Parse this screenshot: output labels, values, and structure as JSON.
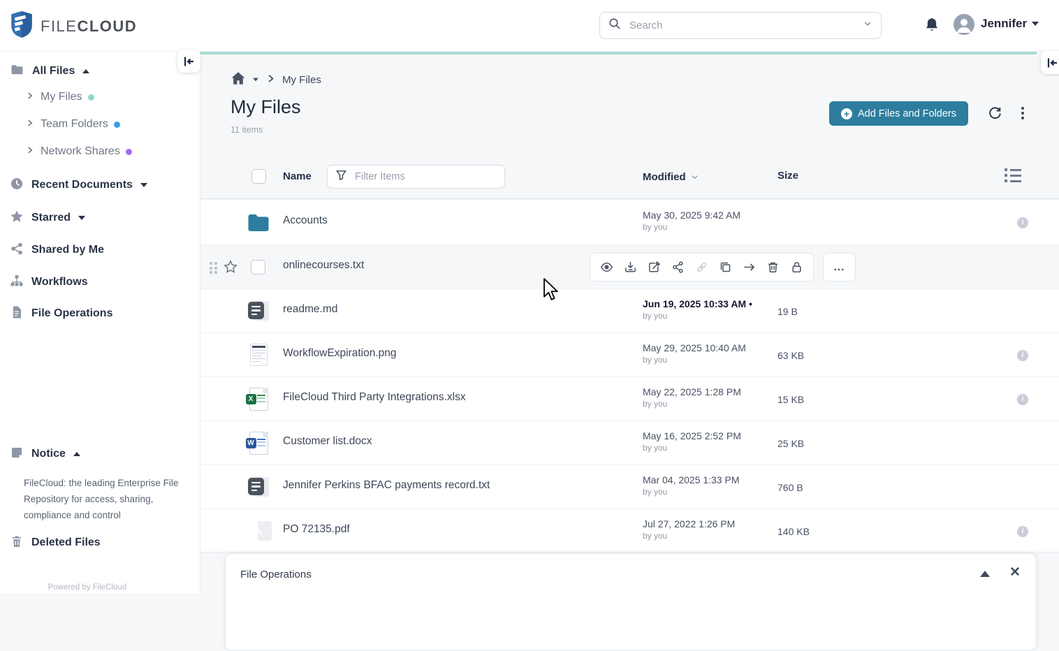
{
  "colors": {
    "accent_loading_bar": "#a9dbd6",
    "primary_button": "#2e7d9e",
    "folder_icon": "#2e7d9e",
    "my_files_dot": "#8fd9c9",
    "team_folders_dot": "#35a0e8",
    "network_shares_dot": "#a36bea",
    "excel_green": "#1e7145",
    "word_blue": "#2b579a",
    "pdf_red": "#d7332a"
  },
  "topbar": {
    "brand": {
      "file": "FILE",
      "cloud": "CLOUD"
    },
    "search_placeholder": "Search",
    "user_name": "Jennifer"
  },
  "sidebar": {
    "all_files": "All Files",
    "my_files": "My Files",
    "team_folders": "Team Folders",
    "network_shares": "Network Shares",
    "recent_documents": "Recent Documents",
    "starred": "Starred",
    "shared_by_me": "Shared by Me",
    "workflows": "Workflows",
    "file_operations": "File Operations",
    "notice": "Notice",
    "notice_text": "FileCloud: the leading Enterprise File Repository for access, sharing, compliance and control",
    "deleted_files": "Deleted Files",
    "powered_by": "Powered by FileCloud"
  },
  "main": {
    "breadcrumb_current": "My Files",
    "title": "My Files",
    "item_count": "11 items",
    "add_button_label": "Add Files and Folders",
    "table": {
      "name_header": "Name",
      "filter_placeholder": "Filter Items",
      "modified_header": "Modified",
      "size_header": "Size",
      "rows": [
        {
          "name": "Accounts",
          "type": "folder",
          "icon": "folder-icon",
          "modified": "May 30, 2025 9:42 AM",
          "by": "by you",
          "size": "",
          "info": true
        },
        {
          "name": "onlinecourses.txt",
          "type": "text",
          "hovered": true,
          "actions": [
            "preview",
            "download",
            "edit",
            "share",
            "link",
            "copy",
            "move",
            "delete",
            "lock"
          ],
          "more_label": "..."
        },
        {
          "name": "readme.md",
          "type": "text",
          "icon": "text-file-icon",
          "modified": "Jun 19, 2025 10:33 AM",
          "recent_marker": "•",
          "by": "by you",
          "size": "19 B"
        },
        {
          "name": "WorkflowExpiration.png",
          "type": "image",
          "icon": "image-file-icon",
          "modified": "May 29, 2025 10:40 AM",
          "by": "by you",
          "size": "63 KB",
          "info": true
        },
        {
          "name": "FileCloud Third Party Integrations.xlsx",
          "type": "excel",
          "icon": "excel-file-icon",
          "modified": "May 22, 2025 1:28 PM",
          "by": "by you",
          "size": "15 KB",
          "info": true
        },
        {
          "name": "Customer list.docx",
          "type": "word",
          "icon": "word-file-icon",
          "modified": "May 16, 2025 2:52 PM",
          "by": "by you",
          "size": "25 KB"
        },
        {
          "name": "Jennifer Perkins BFAC payments record.txt",
          "type": "text",
          "icon": "text-file-icon",
          "modified": "Mar 04, 2025 1:33 PM",
          "by": "by you",
          "size": "760 B"
        },
        {
          "name": "PO 72135.pdf",
          "type": "pdf",
          "icon": "pdf-file-icon",
          "modified": "Jul 27, 2022 1:26 PM",
          "by": "by you",
          "size": "140 KB",
          "info": true
        }
      ]
    }
  },
  "bottom_panel": {
    "title": "File Operations"
  }
}
